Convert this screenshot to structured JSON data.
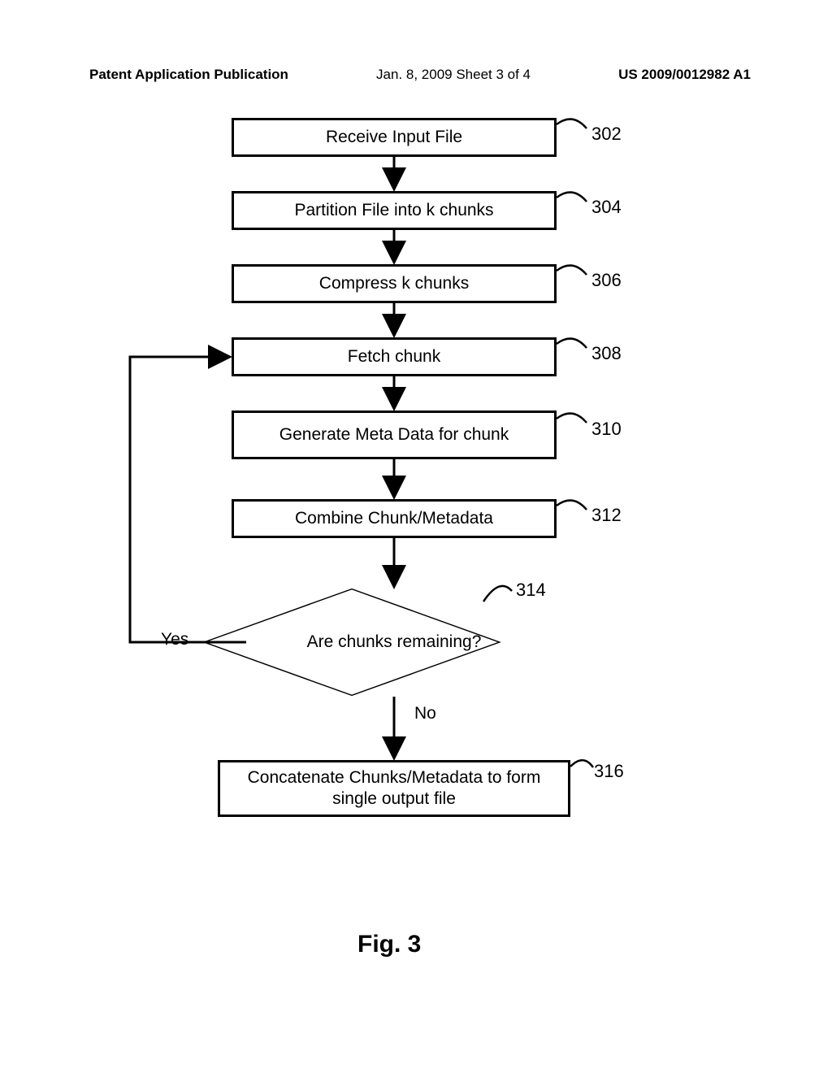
{
  "header": {
    "left": "Patent Application Publication",
    "mid": "Jan. 8, 2009   Sheet 3 of 4",
    "right": "US 2009/0012982 A1"
  },
  "nodes": {
    "n302": "Receive Input File",
    "n304": "Partition File into k chunks",
    "n306": "Compress k chunks",
    "n308": "Fetch chunk",
    "n310": "Generate Meta Data for chunk",
    "n312": "Combine Chunk/Metadata",
    "n314": "Are chunks remaining?",
    "n316": "Concatenate Chunks/Metadata to form single output file"
  },
  "refs": {
    "r302": "302",
    "r304": "304",
    "r306": "306",
    "r308": "308",
    "r310": "310",
    "r312": "312",
    "r314": "314",
    "r316": "316"
  },
  "branches": {
    "yes": "Yes",
    "no": "No"
  },
  "figure": "Fig. 3"
}
